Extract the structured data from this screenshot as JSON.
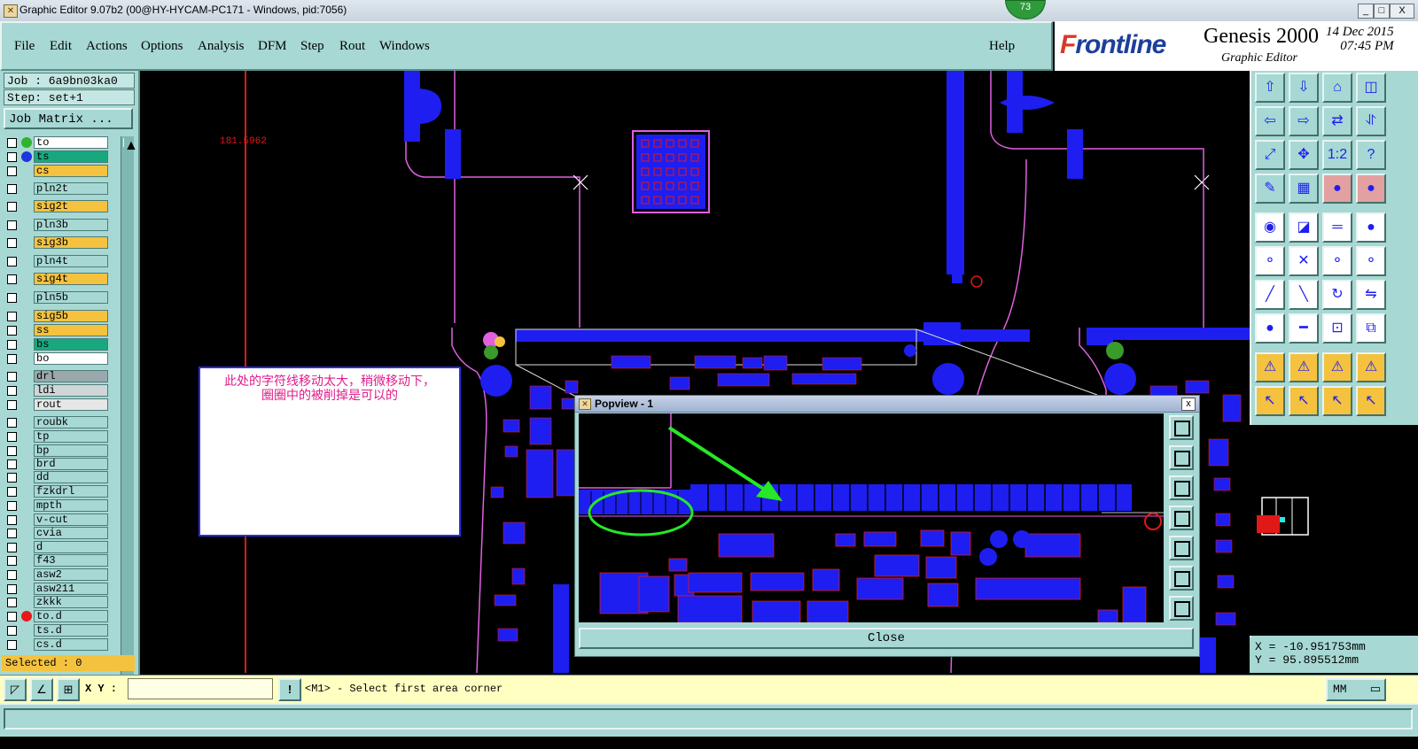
{
  "window": {
    "title": "Graphic Editor 9.07b2 (00@HY-HYCAM-PC171 - Windows, pid:7056)",
    "badge": "73",
    "minimize": "_",
    "maximize": "□",
    "close": "X"
  },
  "menu": [
    "File",
    "Edit",
    "Actions",
    "Options",
    "Analysis",
    "DFM",
    "Step",
    "Rout",
    "Windows"
  ],
  "help": "Help",
  "brand": {
    "logo_prefix": "F",
    "logo_rest": "rontline",
    "product": "Genesis 2000",
    "subtitle": "Graphic Editor",
    "date": "14 Dec 2015",
    "time": "07:45 PM"
  },
  "job": {
    "job_label": "Job : 6a9bn03ka0",
    "step_label": "Step: set+1",
    "job_matrix_button": "Job Matrix ..."
  },
  "layers": [
    {
      "name": "to",
      "color": "#ffffff",
      "dot": "#2db52d"
    },
    {
      "name": "ts",
      "color": "#19a87e",
      "dot": "#1e36e0"
    },
    {
      "name": "cs",
      "color": "#f4c23e",
      "dot": ""
    },
    {
      "name": "pln2t",
      "color": "#a7d8d3",
      "dot": ""
    },
    {
      "name": "sig2t",
      "color": "#f4c23e",
      "dot": ""
    },
    {
      "name": "pln3b",
      "color": "#a7d8d3",
      "dot": ""
    },
    {
      "name": "sig3b",
      "color": "#f4c23e",
      "dot": ""
    },
    {
      "name": "pln4t",
      "color": "#a7d8d3",
      "dot": ""
    },
    {
      "name": "sig4t",
      "color": "#f4c23e",
      "dot": ""
    },
    {
      "name": "pln5b",
      "color": "#a7d8d3",
      "dot": ""
    },
    {
      "name": "sig5b",
      "color": "#f4c23e",
      "dot": ""
    },
    {
      "name": "ss",
      "color": "#f4c23e",
      "dot": ""
    },
    {
      "name": "bs",
      "color": "#19a87e",
      "dot": ""
    },
    {
      "name": "bo",
      "color": "#ffffff",
      "dot": ""
    },
    {
      "name": "drl",
      "color": "#9aa8ac",
      "dot": ""
    },
    {
      "name": "ldi",
      "color": "#cfd6d8",
      "dot": ""
    },
    {
      "name": "rout",
      "color": "#e6e6e6",
      "dot": ""
    },
    {
      "name": "roubk",
      "color": "#a7d8d3",
      "dot": ""
    },
    {
      "name": "tp",
      "color": "#a7d8d3",
      "dot": ""
    },
    {
      "name": "bp",
      "color": "#a7d8d3",
      "dot": ""
    },
    {
      "name": "brd",
      "color": "#a7d8d3",
      "dot": ""
    },
    {
      "name": "dd",
      "color": "#a7d8d3",
      "dot": ""
    },
    {
      "name": "fzkdrl",
      "color": "#a7d8d3",
      "dot": ""
    },
    {
      "name": "mpth",
      "color": "#a7d8d3",
      "dot": ""
    },
    {
      "name": "v-cut",
      "color": "#a7d8d3",
      "dot": ""
    },
    {
      "name": "cvia",
      "color": "#a7d8d3",
      "dot": ""
    },
    {
      "name": "d",
      "color": "#a7d8d3",
      "dot": ""
    },
    {
      "name": "f43",
      "color": "#a7d8d3",
      "dot": ""
    },
    {
      "name": "asw2",
      "color": "#a7d8d3",
      "dot": ""
    },
    {
      "name": "asw211",
      "color": "#a7d8d3",
      "dot": ""
    },
    {
      "name": "zkkk",
      "color": "#a7d8d3",
      "dot": ""
    },
    {
      "name": "to.d",
      "color": "#a7d8d3",
      "dot": "#e81818"
    },
    {
      "name": "ts.d",
      "color": "#a7d8d3",
      "dot": ""
    },
    {
      "name": "cs.d",
      "color": "#a7d8d3",
      "dot": ""
    }
  ],
  "selected": "Selected : 0",
  "canvas": {
    "measure": "181.5962",
    "note_line1": "此处的字符线移动太大，稍微移动下，",
    "note_line2": "圈圈中的被削掉是可以的"
  },
  "popview": {
    "title": "Popview - 1",
    "close_x": "x",
    "close_button": "Close"
  },
  "coords": {
    "x": "X = -10.951753mm",
    "y": "Y = 95.895512mm"
  },
  "command": {
    "xy_label": "X Y :",
    "xy_value": "",
    "bang": "!",
    "prompt": "<M1> - Select first area corner",
    "unit": "MM"
  },
  "colors": {
    "panel": "#a7d8d3",
    "copper": "#1e1ef0",
    "outline": "#e060e0",
    "annotation": "#e01c8a",
    "highlight": "#26e826"
  }
}
